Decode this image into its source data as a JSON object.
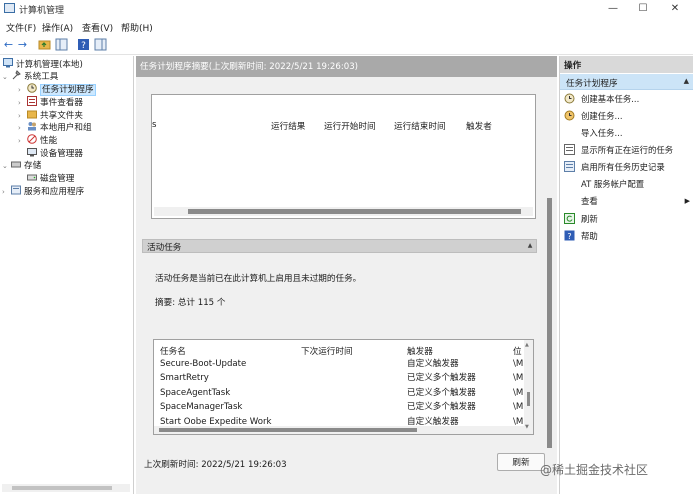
{
  "window": {
    "title": "计算机管理",
    "minimize": "—",
    "maximize": "☐",
    "close": "✕"
  },
  "menu": [
    "文件(F)",
    "操作(A)",
    "查看(V)",
    "帮助(H)"
  ],
  "toolbar": {
    "back": "←",
    "forward": "→"
  },
  "tree": {
    "root": "计算机管理(本地)",
    "system_tools": "系统工具",
    "task_scheduler": "任务计划程序",
    "event_viewer": "事件查看器",
    "shared_folders": "共享文件夹",
    "local_users": "本地用户和组",
    "performance": "性能",
    "device_manager": "设备管理器",
    "storage": "存储",
    "disk_management": "磁盘管理",
    "services_apps": "服务和应用程序"
  },
  "center": {
    "header": "任务计划程序摘要(上次刷新时间: 2022/5/21 19:26:03)",
    "status_columns": [
      "运行结果",
      "运行开始时间",
      "运行结束时间",
      "触发者"
    ],
    "col_stub": "s",
    "active_section": "活动任务",
    "active_desc": "活动任务是当前已在此计算机上启用且未过期的任务。",
    "summary": "摘要: 总计 115 个",
    "table_headers": [
      "任务名",
      "下次运行时间",
      "触发器",
      "位"
    ],
    "rows": [
      {
        "name": "Secure-Boot-Update",
        "next": "",
        "trigger": "自定义触发器",
        "loc": "\\M"
      },
      {
        "name": "SmartRetry",
        "next": "",
        "trigger": "已定义多个触发器",
        "loc": "\\M"
      },
      {
        "name": "SpaceAgentTask",
        "next": "",
        "trigger": "已定义多个触发器",
        "loc": "\\M"
      },
      {
        "name": "SpaceManagerTask",
        "next": "",
        "trigger": "已定义多个触发器",
        "loc": "\\M"
      },
      {
        "name": "Start Oobe Expedite Work",
        "next": "",
        "trigger": "自定义触发器",
        "loc": "\\M"
      }
    ],
    "footer": "上次刷新时间: 2022/5/21 19:26:03",
    "refresh": "刷新"
  },
  "actions": {
    "header": "操作",
    "section": "任务计划程序",
    "items": [
      "创建基本任务...",
      "创建任务...",
      "导入任务...",
      "显示所有正在运行的任务",
      "启用所有任务历史记录",
      "AT 服务帐户配置",
      "查看",
      "刷新",
      "帮助"
    ]
  },
  "watermark": "@稀土掘金技术社区"
}
